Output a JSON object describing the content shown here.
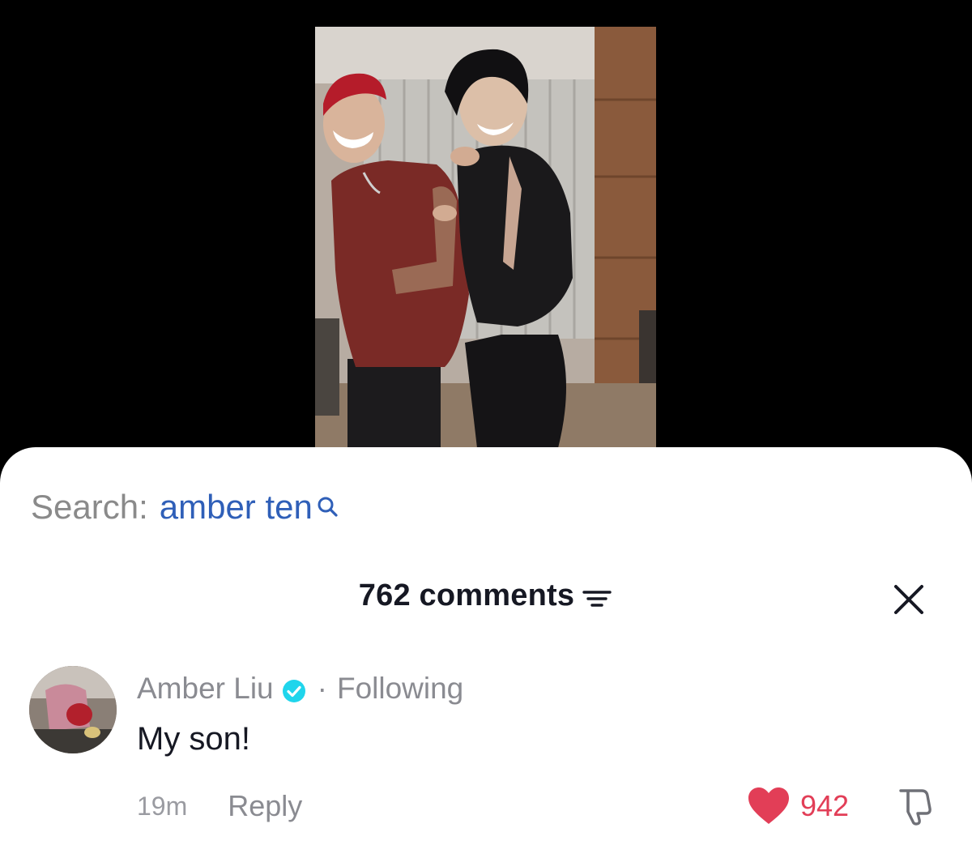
{
  "search": {
    "prefix": "Search:",
    "term": "amber ten"
  },
  "comments_header": {
    "count_label": "762 comments"
  },
  "icons": {
    "search": "search-icon",
    "sort": "sort-filter-icon",
    "close": "close-icon",
    "verified": "verified-badge-icon",
    "like": "heart-icon",
    "dislike": "thumbs-down-icon"
  },
  "comment": {
    "author": "Amber Liu",
    "separator": "·",
    "relationship": "Following",
    "text": "My son!",
    "time": "19m",
    "reply_label": "Reply",
    "likes": "942"
  },
  "colors": {
    "search_term": "#2f5fb8",
    "like": "#e23e57",
    "verified": "#20d5ec",
    "muted_text": "#8a8b91",
    "primary_text": "#161823"
  }
}
